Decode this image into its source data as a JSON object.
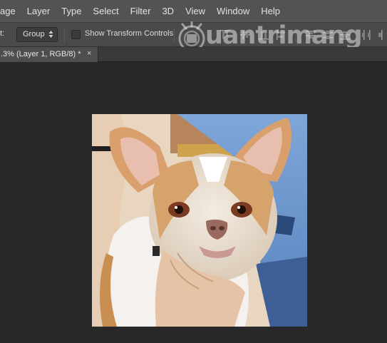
{
  "menu": {
    "items": [
      "age",
      "Layer",
      "Type",
      "Select",
      "Filter",
      "3D",
      "View",
      "Window",
      "Help"
    ]
  },
  "options": {
    "auto_select_label": "t:",
    "auto_select_value": "Group",
    "show_transform_label": "Show Transform Controls"
  },
  "watermark": {
    "text": "uantrimang"
  },
  "document": {
    "tab_title": ".3% (Layer 1, RGB/8) *",
    "close_glyph": "×"
  },
  "colors": {
    "menubar": "#535353",
    "optionsbar": "#4a4a4a",
    "workspace": "#282828"
  }
}
